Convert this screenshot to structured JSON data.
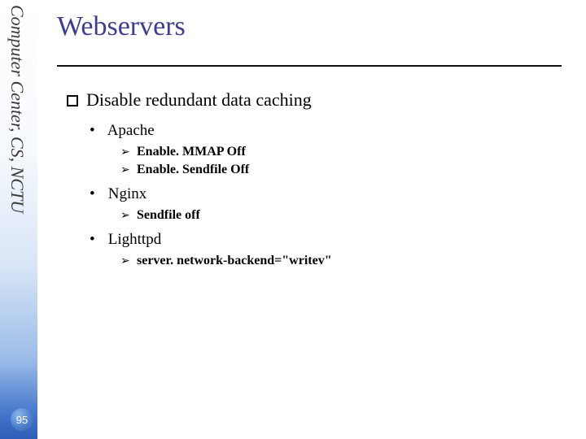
{
  "sidebar": {
    "label": "Computer Center, CS, NCTU"
  },
  "page_number": "95",
  "title": "Webservers",
  "section": {
    "heading": "Disable redundant data caching",
    "items": [
      {
        "name": "Apache",
        "sub": [
          "Enable. MMAP Off",
          "Enable. Sendfile Off"
        ]
      },
      {
        "name": "Nginx",
        "sub": [
          "Sendfile off"
        ]
      },
      {
        "name": "Lighttpd",
        "sub": [
          "server. network-backend=\"writev\""
        ]
      }
    ]
  }
}
